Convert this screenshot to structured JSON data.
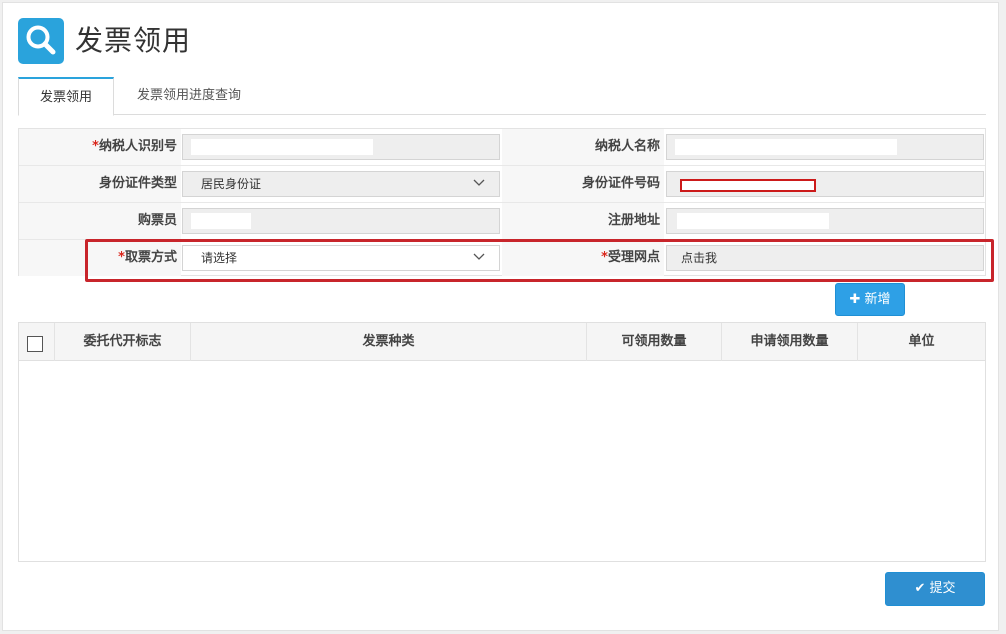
{
  "header": {
    "title": "发票领用",
    "icon": "search-icon"
  },
  "tabs": [
    {
      "label": "发票领用",
      "active": true
    },
    {
      "label": "发票领用进度查询",
      "active": false
    }
  ],
  "form": {
    "row1": {
      "left_label": "纳税人识别号",
      "left_required": true,
      "right_label": "纳税人名称",
      "right_required": false
    },
    "row2": {
      "left_label": "身份证件类型",
      "left_value": "居民身份证",
      "right_label": "身份证件号码"
    },
    "row3": {
      "left_label": "购票员",
      "right_label": "注册地址"
    },
    "row4": {
      "left_label": "取票方式",
      "left_required": true,
      "left_placeholder": "请选择",
      "right_label": "受理网点",
      "right_required": true,
      "right_value": "点击我"
    },
    "required_mark": "*"
  },
  "buttons": {
    "add": "新增",
    "submit": "提交"
  },
  "table": {
    "columns": [
      "委托代开标志",
      "发票种类",
      "可领用数量",
      "申请领用数量",
      "单位"
    ]
  },
  "colors": {
    "accent": "#2aa3dc",
    "required": "#d9261c",
    "highlight": "#c8252b"
  }
}
